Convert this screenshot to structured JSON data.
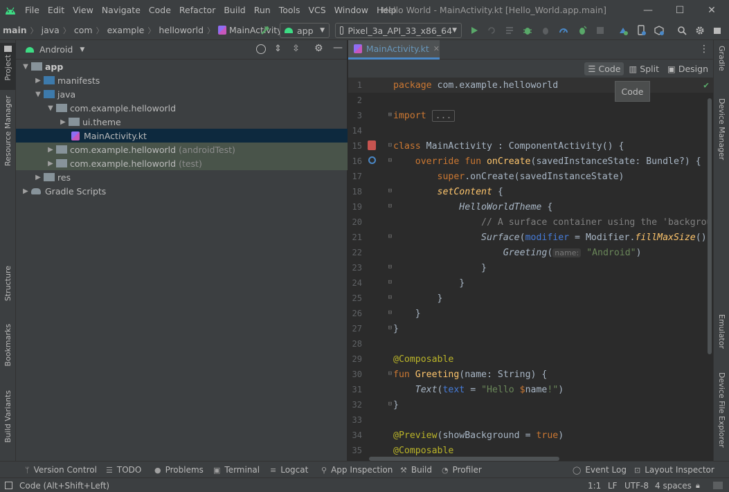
{
  "window": {
    "title": "Hello World - MainActivity.kt [Hello_World.app.main]",
    "menu": [
      "File",
      "Edit",
      "View",
      "Navigate",
      "Code",
      "Refactor",
      "Build",
      "Run",
      "Tools",
      "VCS",
      "Window",
      "Help"
    ],
    "controls": {
      "minimize": "—",
      "maximize": "☐",
      "close": "✕"
    }
  },
  "navbar": {
    "breadcrumbs": [
      "main",
      "java",
      "com",
      "example",
      "helloworld",
      "MainActivity.kt"
    ],
    "run_config": "app",
    "device": "Pixel_3a_API_33_x86_64"
  },
  "left_tabs": [
    "Project",
    "Resource Manager",
    "Structure",
    "Bookmarks",
    "Build Variants"
  ],
  "right_tabs": [
    "Gradle",
    "Device Manager",
    "Emulator",
    "Device File Explorer"
  ],
  "project": {
    "view": "Android",
    "tree": [
      {
        "label": "app",
        "secondary": ""
      },
      {
        "label": "manifests",
        "secondary": ""
      },
      {
        "label": "java",
        "secondary": ""
      },
      {
        "label": "com.example.helloworld",
        "secondary": ""
      },
      {
        "label": "ui.theme",
        "secondary": ""
      },
      {
        "label": "MainActivity.kt",
        "secondary": ""
      },
      {
        "label": "com.example.helloworld",
        "secondary": "(androidTest)"
      },
      {
        "label": "com.example.helloworld",
        "secondary": "(test)"
      },
      {
        "label": "res",
        "secondary": ""
      },
      {
        "label": "Gradle Scripts",
        "secondary": ""
      }
    ]
  },
  "editor": {
    "tab": "MainActivity.kt",
    "view_modes": [
      "Code",
      "Split",
      "Design"
    ],
    "tooltip": "Code",
    "line_numbers": [
      "1",
      "2",
      "3",
      "14",
      "15",
      "16",
      "17",
      "18",
      "19",
      "20",
      "21",
      "22",
      "23",
      "24",
      "25",
      "26",
      "27",
      "28",
      "29",
      "30",
      "31",
      "32",
      "33",
      "34",
      "35"
    ],
    "code": {
      "l1": [
        "package",
        " com.example.helloworld"
      ],
      "l3": [
        "import",
        " ",
        "..."
      ],
      "l15": [
        "class",
        " MainActivity : ComponentActivity() {"
      ],
      "l16": [
        "    override fun ",
        "onCreate",
        "(savedInstanceState: Bundle?) {"
      ],
      "l17": [
        "        super",
        ".onCreate(savedInstanceState)"
      ],
      "l18": [
        "        ",
        "setContent",
        " {"
      ],
      "l19": [
        "            ",
        "HelloWorldTheme",
        " {"
      ],
      "l20": [
        "                // A surface container using the 'backgrou"
      ],
      "l21": [
        "                ",
        "Surface",
        "(",
        "modifier",
        " = ",
        "Modifier.",
        "fillMaxSize",
        "(),"
      ],
      "l22": [
        "                    ",
        "Greeting",
        "(",
        "name:",
        " ",
        "\"Android\"",
        ")"
      ],
      "l23": [
        "                }"
      ],
      "l24": [
        "            }"
      ],
      "l25": [
        "        }"
      ],
      "l26": [
        "    }"
      ],
      "l27": [
        "}"
      ],
      "l29": [
        "@Composable"
      ],
      "l30": [
        "fun ",
        "Greeting",
        "(name: String) {"
      ],
      "l31": [
        "    ",
        "Text",
        "(",
        "text",
        " = ",
        "\"Hello ",
        "$",
        "name",
        "!\"",
        ")"
      ],
      "l32": [
        "}"
      ],
      "l34": [
        "@Preview",
        "(showBackground = ",
        "true",
        ")"
      ],
      "l35": [
        "@Composable"
      ]
    }
  },
  "bottom_tools": [
    "Version Control",
    "TODO",
    "Problems",
    "Terminal",
    "Logcat",
    "App Inspection",
    "Build",
    "Profiler",
    "Event Log",
    "Layout Inspector"
  ],
  "status": {
    "message": "Code (Alt+Shift+Left)",
    "position": "1:1",
    "line_sep": "LF",
    "encoding": "UTF-8",
    "indent": "4 spaces"
  },
  "colors": {
    "accent": "#4a88c7",
    "selection": "#0d293e",
    "test_bg": "#49544a",
    "keyword": "#cc7832",
    "function": "#ffc66d",
    "string": "#6a8759"
  }
}
